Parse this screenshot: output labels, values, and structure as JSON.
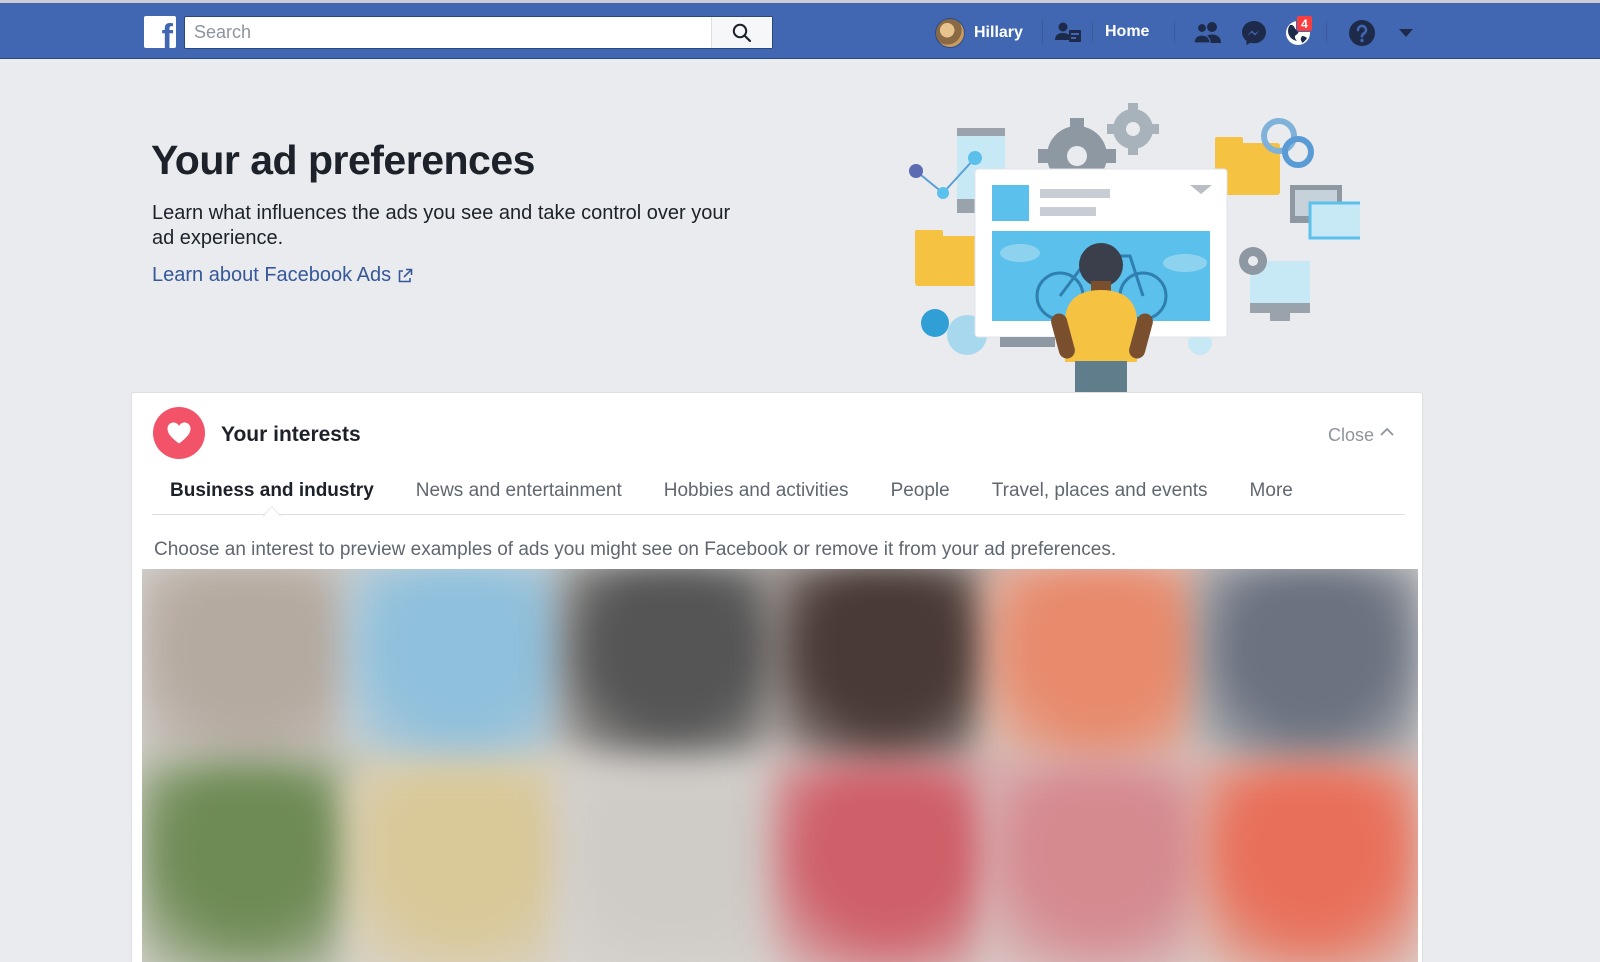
{
  "topbar": {
    "logo_letter": "f",
    "search": {
      "placeholder": "Search",
      "value": ""
    },
    "profile_name": "Hillary",
    "home_label": "Home",
    "notification_count": "4",
    "icons": [
      "search-icon",
      "find-friends-icon",
      "friend-requests-icon",
      "messenger-icon",
      "notifications-globe-icon",
      "help-icon",
      "account-menu-chevron-icon"
    ],
    "colors": {
      "bar": "#4267b2",
      "badge": "#fa3e3e"
    }
  },
  "header": {
    "title": "Your ad preferences",
    "description": "Learn what influences the ads you see and take control over your ad experience.",
    "learn_link": "Learn about Facebook Ads"
  },
  "interests": {
    "title": "Your interests",
    "close_label": "Close",
    "tabs": [
      {
        "label": "Business and industry",
        "active": true
      },
      {
        "label": "News and entertainment",
        "active": false
      },
      {
        "label": "Hobbies and activities",
        "active": false
      },
      {
        "label": "People",
        "active": false
      },
      {
        "label": "Travel, places and events",
        "active": false
      },
      {
        "label": "More",
        "active": false
      }
    ],
    "instructions": "Choose an interest to preview examples of ads you might see on Facebook or remove it from your ad preferences.",
    "tile_colors": [
      [
        "#b5aaa0",
        "#8fc0dc",
        "#555555",
        "#4a3a36",
        "#e88a6c",
        "#6b7280"
      ],
      [
        "#6f8b55",
        "#d9c898",
        "#cfcbc6",
        "#cf5f68",
        "#d58a90",
        "#e8705a"
      ]
    ],
    "accent": "#f35369"
  }
}
